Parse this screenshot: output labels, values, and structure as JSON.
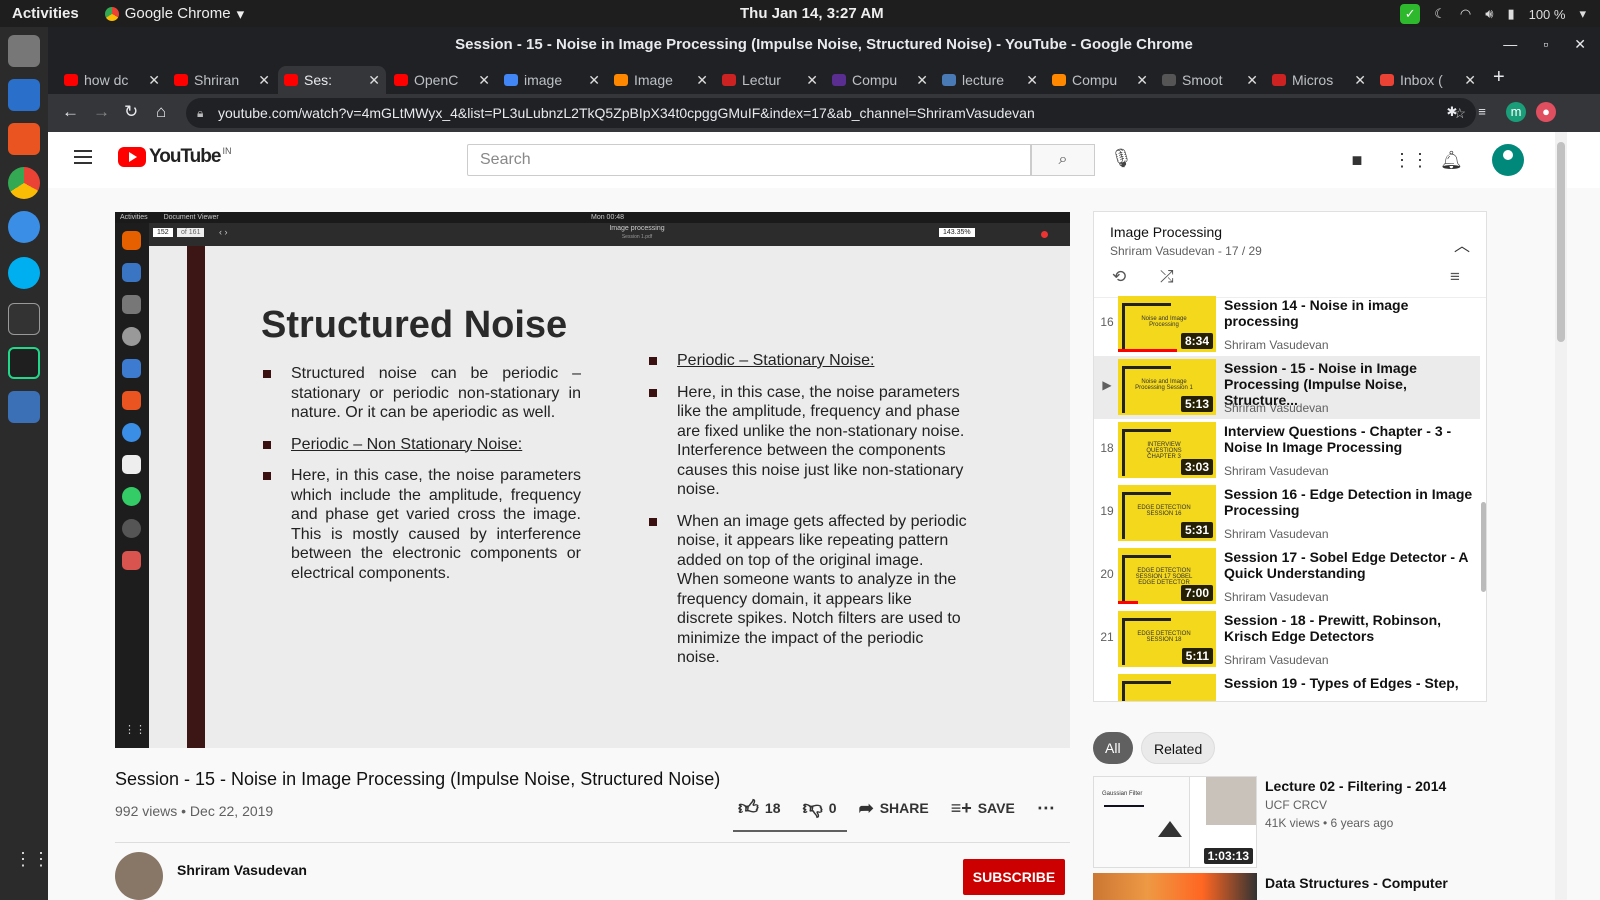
{
  "system": {
    "activities": "Activities",
    "app_name": "Google Chrome",
    "clock": "Thu Jan 14,  3:27 AM",
    "battery": "100 %"
  },
  "window": {
    "title": "Session - 15 - Noise in Image Processing (Impulse Noise, Structured Noise) - YouTube - Google Chrome"
  },
  "tabs": [
    {
      "label": "how dc",
      "fav": "#ff0000"
    },
    {
      "label": "Shriran",
      "fav": "#ff0000"
    },
    {
      "label": "Ses:",
      "fav": "#ff0000"
    },
    {
      "label": "OpenC",
      "fav": "#ff0000"
    },
    {
      "label": "image",
      "fav": "#4285f4"
    },
    {
      "label": "Image",
      "fav": "#ff8800"
    },
    {
      "label": "Lectur",
      "fav": "#cc2222"
    },
    {
      "label": "Compu",
      "fav": "#5a2d91"
    },
    {
      "label": "lecture",
      "fav": "#4a7ab5"
    },
    {
      "label": "Compu",
      "fav": "#ff8800"
    },
    {
      "label": "Smoot",
      "fav": "#555555"
    },
    {
      "label": "Micros",
      "fav": "#cc2222"
    },
    {
      "label": "Inbox (",
      "fav": "#ea4335"
    }
  ],
  "url": "youtube.com/watch?v=4mGLtMWyx_4&list=PL3uLubnzL2TkQ5ZpBIpX34t0cpggGMuIF&index=17&ab_channel=ShriramVasudevan",
  "youtube": {
    "logo": "YouTube",
    "region": "IN",
    "search_placeholder": "Search"
  },
  "slide": {
    "desktop_label": "Activities",
    "app_label": "Document Viewer",
    "time": "Mon 00:48",
    "doc_title": "Image processing",
    "doc_sub": "Session 1.pdf",
    "page": "152",
    "of": "of 161",
    "zoom": "143.35%",
    "title": "Structured Noise",
    "left": [
      {
        "text": "Structured noise can be periodic – stationary or periodic non-stationary in nature. Or it can be aperiodic as well.",
        "u": false
      },
      {
        "text": "Periodic – Non Stationary Noise:",
        "u": true
      },
      {
        "text": "Here, in this case, the noise parameters which include the amplitude, frequency and phase get varied cross the image. This is mostly caused by interference between the electronic components or electrical components.",
        "u": false
      }
    ],
    "right": [
      {
        "text": "Periodic – Stationary Noise:",
        "u": true
      },
      {
        "text": "Here, in this case, the noise parameters like the amplitude, frequency and phase are fixed unlike the non-stationary noise. Interference between the components causes this noise just like non-stationary noise.",
        "u": false
      },
      {
        "text": "When an image gets affected by periodic noise, it appears like repeating pattern added on top of the original image. When someone wants to analyze in the frequency domain, it appears like discrete spikes. Notch filters are used to minimize the impact of the periodic noise.",
        "u": false
      }
    ]
  },
  "video": {
    "title": "Session - 15 - Noise in Image Processing (Impulse Noise, Structured Noise)",
    "meta": "992 views • Dec 22, 2019",
    "likes": "18",
    "dislikes": "0",
    "share": "SHARE",
    "save": "SAVE",
    "channel": "Shriram Vasudevan",
    "subscribe": "SUBSCRIBE"
  },
  "playlist": {
    "title": "Image Processing",
    "subtitle": "Shriram Vasudevan - 17 / 29",
    "items": [
      {
        "num": "16",
        "title": "Session 14 - Noise in image processing",
        "channel": "Shriram Vasudevan",
        "dur": "8:34",
        "thumb": "Noise and Image Processing",
        "progress": 0.6
      },
      {
        "num": "▶",
        "title": "Session - 15 - Noise in Image Processing (Impulse Noise, Structure...",
        "channel": "Shriram Vasudevan",
        "dur": "5:13",
        "thumb": "Noise and Image Processing Session 1",
        "progress": 0
      },
      {
        "num": "18",
        "title": "Interview Questions - Chapter - 3 - Noise In Image Processing",
        "channel": "Shriram Vasudevan",
        "dur": "3:03",
        "thumb": "INTERVIEW QUESTIONS CHAPTER 3",
        "progress": 0
      },
      {
        "num": "19",
        "title": "Session 16 - Edge Detection in Image Processing",
        "channel": "Shriram Vasudevan",
        "dur": "5:31",
        "thumb": "EDGE DETECTION SESSION 16",
        "progress": 0
      },
      {
        "num": "20",
        "title": "Session 17 - Sobel Edge Detector - A Quick Understanding",
        "channel": "Shriram Vasudevan",
        "dur": "7:00",
        "thumb": "EDGE DETECTION SESSION 17 SOBEL EDGE DETECTOR",
        "progress": 0.2
      },
      {
        "num": "21",
        "title": "Session - 18 - Prewitt, Robinson, Krisch Edge Detectors",
        "channel": "Shriram Vasudevan",
        "dur": "5:11",
        "thumb": "EDGE DETECTION SESSION 18",
        "progress": 0
      },
      {
        "num": "",
        "title": "Session 19 - Types of Edges - Step,",
        "channel": "",
        "dur": "",
        "thumb": "",
        "progress": 0
      }
    ]
  },
  "chips": [
    "All",
    "Related"
  ],
  "related": {
    "title": "Lecture 02 - Filtering - 2014",
    "channel": "UCF CRCV",
    "meta": "41K views • 6 years ago",
    "dur": "1:03:13",
    "thumb_label": "Gaussian Filter",
    "next_title": "Data Structures - Computer"
  },
  "colors": {
    "accent": "#ff0000",
    "subscribe": "#cc0000",
    "slide_bar": "#3c1515",
    "thumb_yellow": "#f4d81c"
  }
}
